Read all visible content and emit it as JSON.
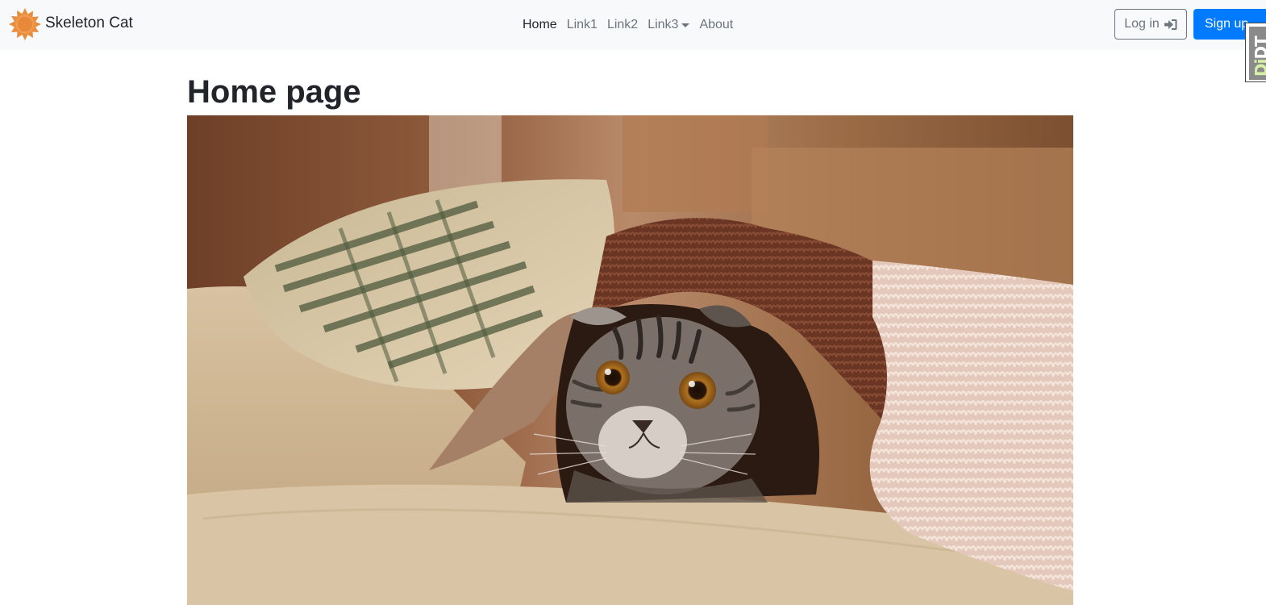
{
  "navbar": {
    "brand": {
      "name": "Skeleton Cat",
      "logo_icon": "sun-star-logo-icon",
      "logo_color": "#e88c3d"
    },
    "links": [
      {
        "label": "Home",
        "active": true
      },
      {
        "label": "Link1",
        "active": false
      },
      {
        "label": "Link2",
        "active": false
      },
      {
        "label": "Link3",
        "active": false,
        "dropdown": true
      },
      {
        "label": "About",
        "active": false
      }
    ],
    "login_label": "Log in",
    "login_icon": "sign-in-icon",
    "signup_label": "Sign up",
    "accent_color": "#007bff"
  },
  "debug_toolbar": {
    "label_dj": "Dj",
    "label_dt": "DT"
  },
  "main": {
    "title": "Home page",
    "hero_image": {
      "subject": "tabby cat peeking out from under a shaggy blanket on a sofa",
      "dominant_colors": [
        "#7b4b2e",
        "#d9c4a5",
        "#5a2e1e",
        "#e8cfc2"
      ]
    }
  }
}
